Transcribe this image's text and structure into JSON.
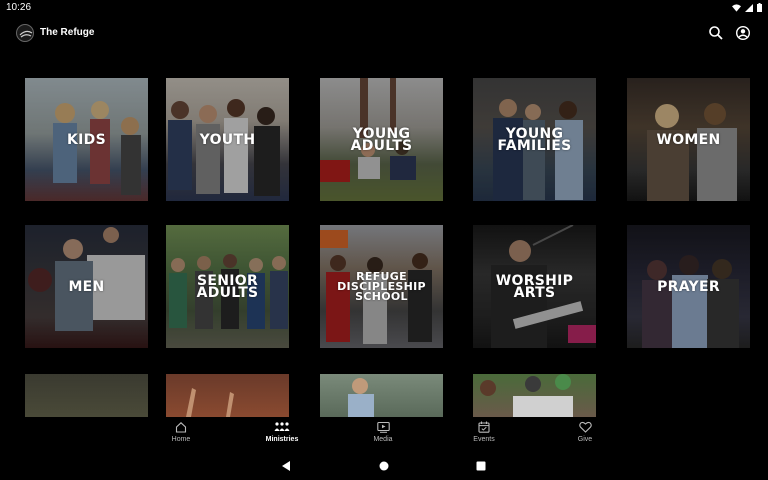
{
  "status_bar": {
    "time": "10:26"
  },
  "app_bar": {
    "title": "The Refuge"
  },
  "ministries": [
    {
      "label": "KIDS"
    },
    {
      "label": "YOUTH"
    },
    {
      "label": "YOUNG ADULTS"
    },
    {
      "label": "YOUNG FAMILIES"
    },
    {
      "label": "WOMEN"
    },
    {
      "label": "MEN"
    },
    {
      "label": "SENIOR ADULTS"
    },
    {
      "label": "REFUGE DISCIPLESHIP SCHOOL"
    },
    {
      "label": "WORSHIP ARTS"
    },
    {
      "label": "PRAYER"
    }
  ],
  "bottom_nav": [
    {
      "label": "Home",
      "icon": "home-icon"
    },
    {
      "label": "Ministries",
      "icon": "ministries-icon",
      "active": true
    },
    {
      "label": "Media",
      "icon": "media-icon"
    },
    {
      "label": "Events",
      "icon": "events-icon"
    },
    {
      "label": "Give",
      "icon": "heart-icon"
    }
  ],
  "colors": {
    "background": "#000000",
    "text": "#ffffff",
    "inactive_nav": "#bbbbbb"
  }
}
